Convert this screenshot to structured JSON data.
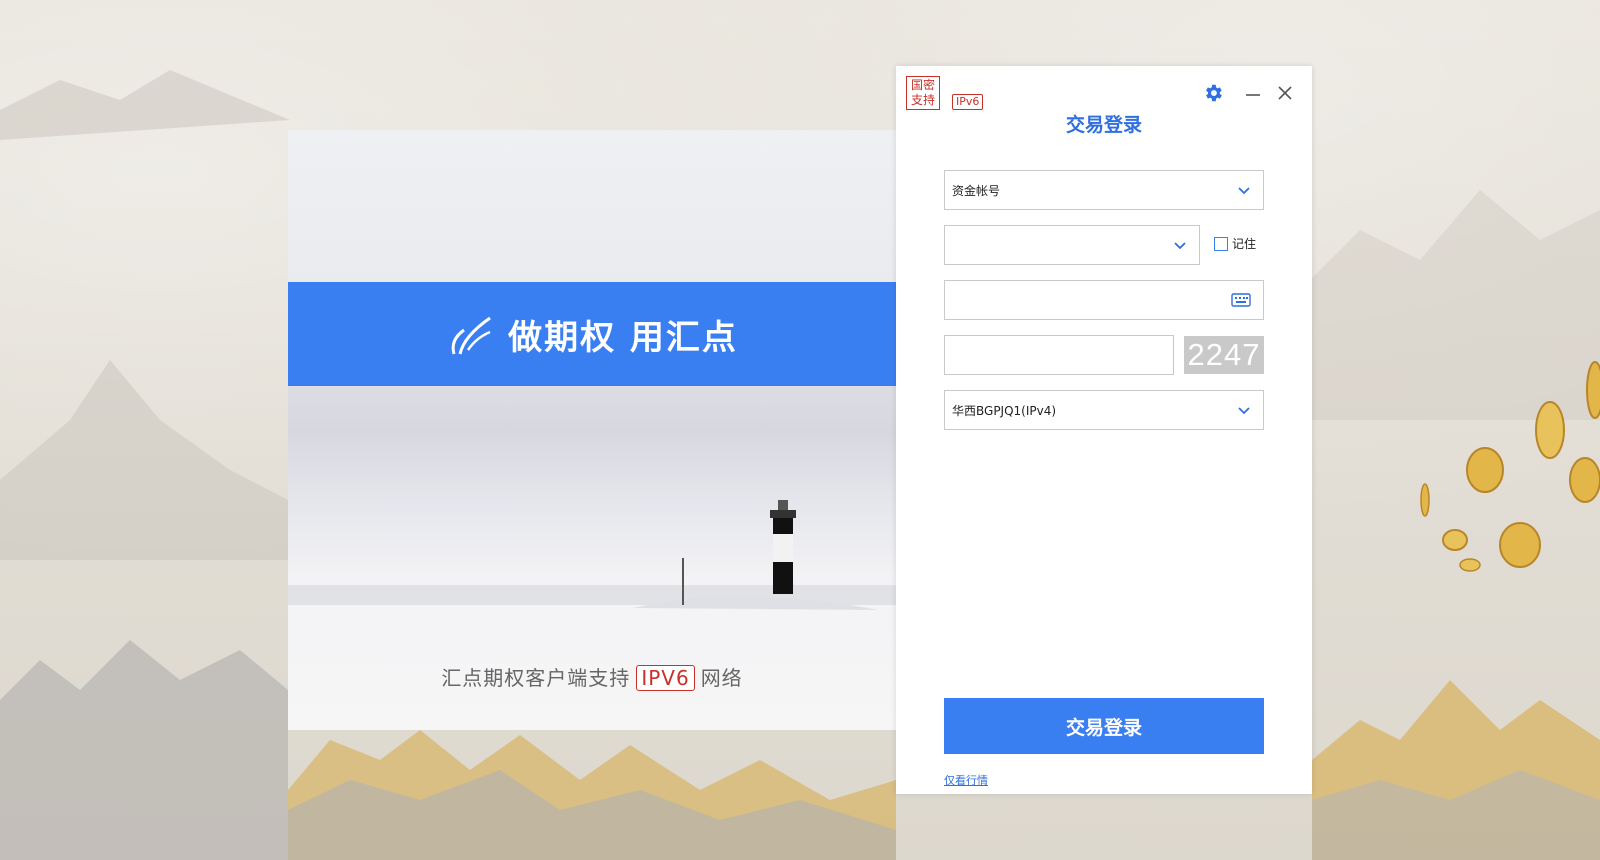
{
  "banner": {
    "slogan": "做期权 用汇点",
    "tagline_before": "汇点期权客户端支持",
    "tagline_tag": "IPV6",
    "tagline_after": "网络"
  },
  "dialog": {
    "badge_gm": "国密\n支持",
    "badge_gm_line1": "国密",
    "badge_gm_line2": "支持",
    "badge_ipv6": "IPv6",
    "title": "交易登录",
    "account_type": "资金帐号",
    "remember_label": "记住",
    "captcha": "2247",
    "server": "华西BGPJQ1(IPv4)",
    "login_button": "交易登录",
    "quote_only_link": "仅看行情"
  },
  "colors": {
    "primary": "#3a7ff2",
    "badge_red": "#c8302a"
  },
  "icons": {
    "settings": "gear-icon",
    "minimize": "minimize-icon",
    "close": "close-icon",
    "dropdown": "chevron-down-icon",
    "keyboard": "keyboard-icon"
  }
}
